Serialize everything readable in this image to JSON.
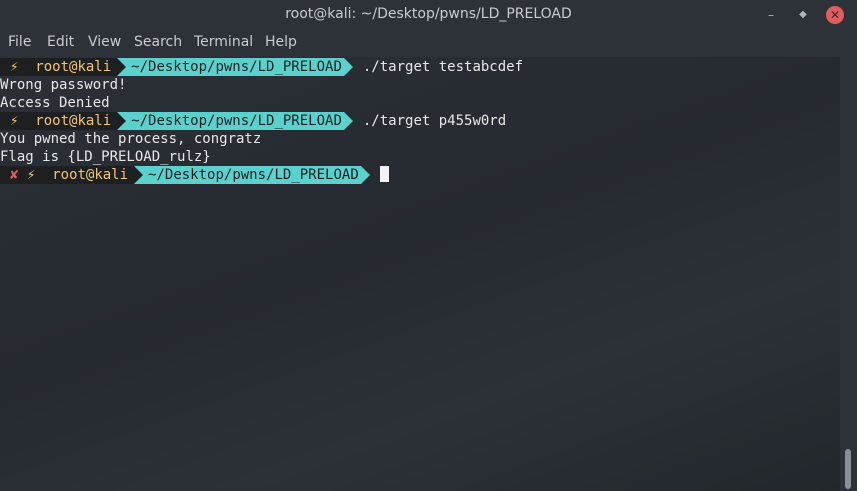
{
  "window": {
    "title": "root@kali: ~/Desktop/pwns/LD_PRELOAD",
    "min_glyph": "–",
    "max_glyph": "◆",
    "close_glyph": "✕"
  },
  "menu": [
    "File",
    "Edit",
    "View",
    "Search",
    "Terminal",
    "Help"
  ],
  "prompt": {
    "bolt": "⚡",
    "fail": "✘",
    "user": "root@kali",
    "path": "~/Desktop/pwns/LD_PRELOAD"
  },
  "session": {
    "cmd1": "./target testabcdef",
    "out1": [
      "Wrong password!",
      "Access Denied"
    ],
    "cmd2": "./target p455w0rd",
    "out2": [
      "You pwned the process, congratz",
      "Flag is {LD_PRELOAD_rulz}"
    ]
  },
  "colors": {
    "prompt_user_bg": "#1d1f21",
    "prompt_path_bg": "#5ad1cc",
    "prompt_user_fg": "#f0c674",
    "fail_mark": "#e25c5c",
    "close_button": "#e25c5c"
  }
}
